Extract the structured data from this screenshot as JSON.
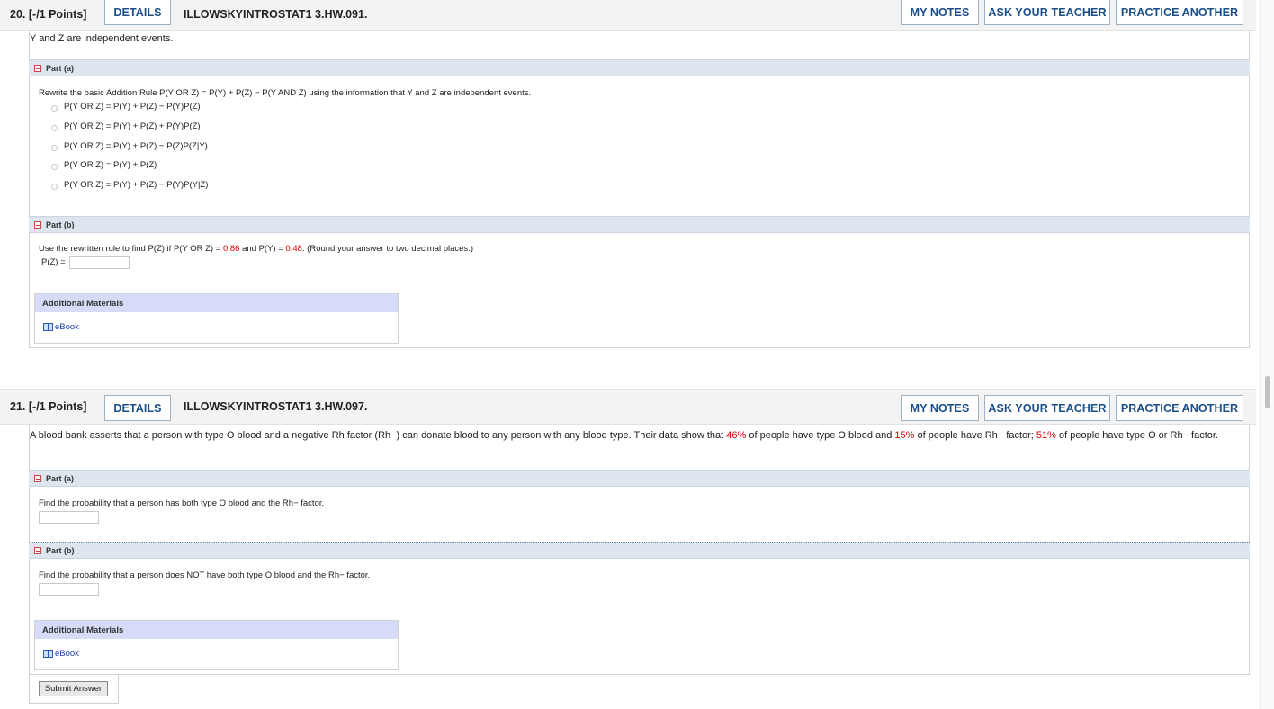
{
  "q20": {
    "number": "20.",
    "points": "[-/1 Points]",
    "details": "DETAILS",
    "code": "ILLOWSKYINTROSTAT1 3.HW.091.",
    "my_notes": "MY NOTES",
    "ask_teacher": "ASK YOUR TEACHER",
    "practice": "PRACTICE ANOTHER",
    "stem": "Y and Z are independent events.",
    "part_a": {
      "label": "Part (a)",
      "prompt": "Rewrite the basic Addition Rule  P(Y OR Z) = P(Y) + P(Z) − P(Y AND Z)  using the information that Y and Z are independent events.",
      "options": [
        "P(Y OR Z) = P(Y) + P(Z) − P(Y)P(Z)",
        "P(Y OR Z) = P(Y) + P(Z) + P(Y)P(Z)",
        "P(Y OR Z) = P(Y) + P(Z) − P(Z)P(Z|Y)",
        "P(Y OR Z) = P(Y) + P(Z)",
        "P(Y OR Z) = P(Y) + P(Z) − P(Y)P(Y|Z)"
      ]
    },
    "part_b": {
      "label": "Part (b)",
      "prompt_pre": "Use the rewritten rule to find  P(Z)  if  P(Y OR Z) = ",
      "value1": "0.86",
      "prompt_mid": "  and  P(Y) = ",
      "value2": "0.48",
      "prompt_post": ".  (Round your answer to two decimal places.)",
      "answer_label": "P(Z) ="
    },
    "additional": {
      "title": "Additional Materials",
      "ebook": "eBook"
    }
  },
  "q21": {
    "number": "21.",
    "points": "[-/1 Points]",
    "details": "DETAILS",
    "code": "ILLOWSKYINTROSTAT1 3.HW.097.",
    "my_notes": "MY NOTES",
    "ask_teacher": "ASK YOUR TEACHER",
    "practice": "PRACTICE ANOTHER",
    "stem_1": "A blood bank asserts that a person with type O blood and a negative Rh factor (Rh−) can donate blood to any person with any blood type. Their data show that ",
    "pct_1": "46%",
    "stem_2": " of people have type O blood and ",
    "pct_2": "15%",
    "stem_3": " of people have Rh− factor; ",
    "pct_3": "51%",
    "stem_4": " of people have type O or Rh− factor.",
    "part_a": {
      "label": "Part (a)",
      "prompt": "Find the probability that a person has both type O blood and the Rh− factor."
    },
    "part_b": {
      "label": "Part (b)",
      "prompt": "Find the probability that a person does NOT have both type O blood and the Rh− factor."
    },
    "additional": {
      "title": "Additional Materials",
      "ebook": "eBook"
    },
    "submit": "Submit Answer"
  }
}
